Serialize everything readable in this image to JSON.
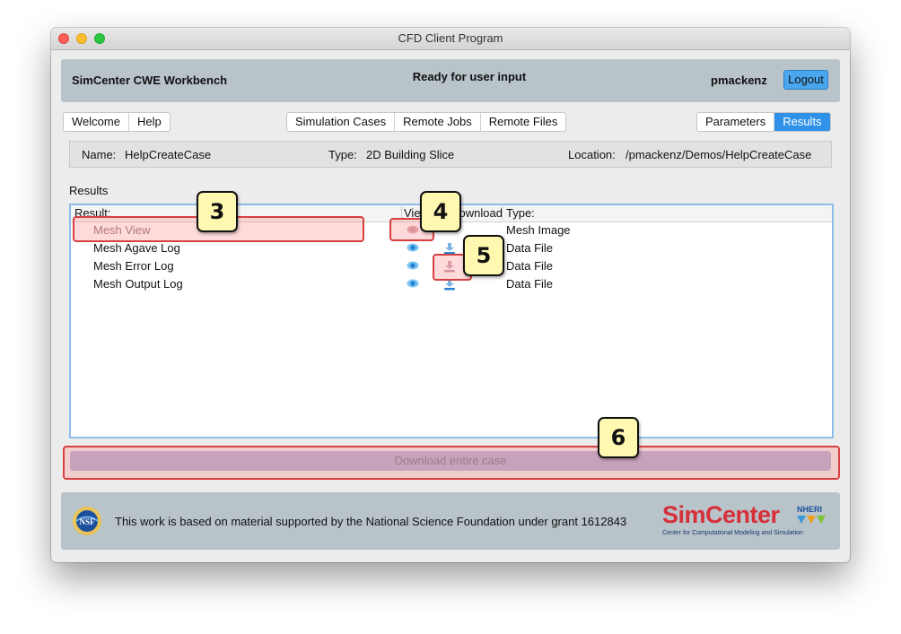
{
  "window": {
    "title": "CFD Client Program"
  },
  "header": {
    "app_name": "SimCenter CWE Workbench",
    "status": "Ready for user input",
    "username": "pmackenz",
    "logout_label": "Logout"
  },
  "tabs": {
    "left": [
      "Welcome",
      "Help"
    ],
    "center": [
      "Simulation Cases",
      "Remote Jobs",
      "Remote Files"
    ],
    "right": [
      "Parameters",
      "Results"
    ],
    "active": "Results"
  },
  "case_info": {
    "name_label": "Name:",
    "name_value": "HelpCreateCase",
    "type_label": "Type:",
    "type_value": "2D Building Slice",
    "location_label": "Location:",
    "location_value": "/pmackenz/Demos/HelpCreateCase"
  },
  "results": {
    "section_label": "Results",
    "columns": {
      "result": "Result:",
      "view": "View",
      "download": "Download",
      "type": "Type:"
    },
    "rows": [
      {
        "name": "Mesh View",
        "type": "Mesh Image",
        "has_download": false
      },
      {
        "name": "Mesh Agave Log",
        "type": "Data File",
        "has_download": true
      },
      {
        "name": "Mesh Error Log",
        "type": "Data File",
        "has_download": true
      },
      {
        "name": "Mesh Output Log",
        "type": "Data File",
        "has_download": true
      }
    ]
  },
  "download_all_label": "Download entire case",
  "footer": {
    "text": "This work is based on material supported by the National Science Foundation under grant 1612843",
    "logo_nsf": "NSF",
    "logo_simcenter": "SimCenter",
    "logo_nheri": "NHERI",
    "logo_subtitle": "Center for Computational Modeling and Simulation"
  },
  "callouts": [
    "3",
    "4",
    "5",
    "6"
  ],
  "colors": {
    "accent": "#2f92e8",
    "header_panel": "#b9c3ca",
    "highlight": "#d64040",
    "callout_fill": "#fff8b0",
    "simcenter_red": "#d6303a"
  },
  "icons": {
    "view": "eye-icon",
    "download": "download-icon"
  }
}
